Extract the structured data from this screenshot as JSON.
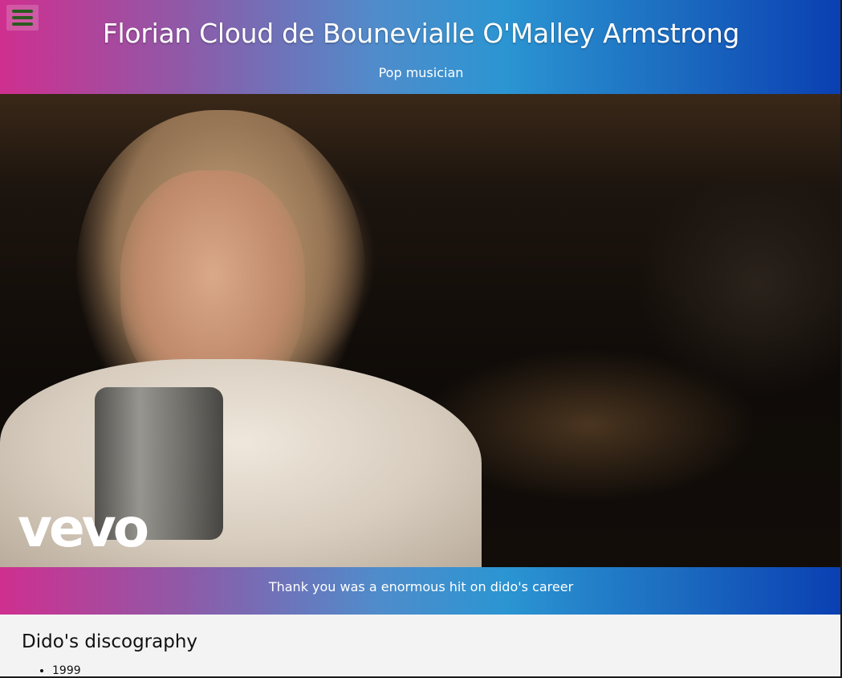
{
  "header": {
    "title": "Florian Cloud de Bounevialle O'Malley Armstrong",
    "subtitle": "Pop musician",
    "menu_icon": "hamburger-menu-icon"
  },
  "video": {
    "watermark": "vevo",
    "caption": "Thank you was a enormous hit on dido's career"
  },
  "main": {
    "heading": "Dido's discography",
    "discography": [
      "1999"
    ]
  },
  "colors": {
    "gradient_start": "#cf2f8f",
    "gradient_mid": "#2b95d2",
    "gradient_end": "#0a3fb2",
    "menu_icon_color": "#2b5a1f"
  }
}
